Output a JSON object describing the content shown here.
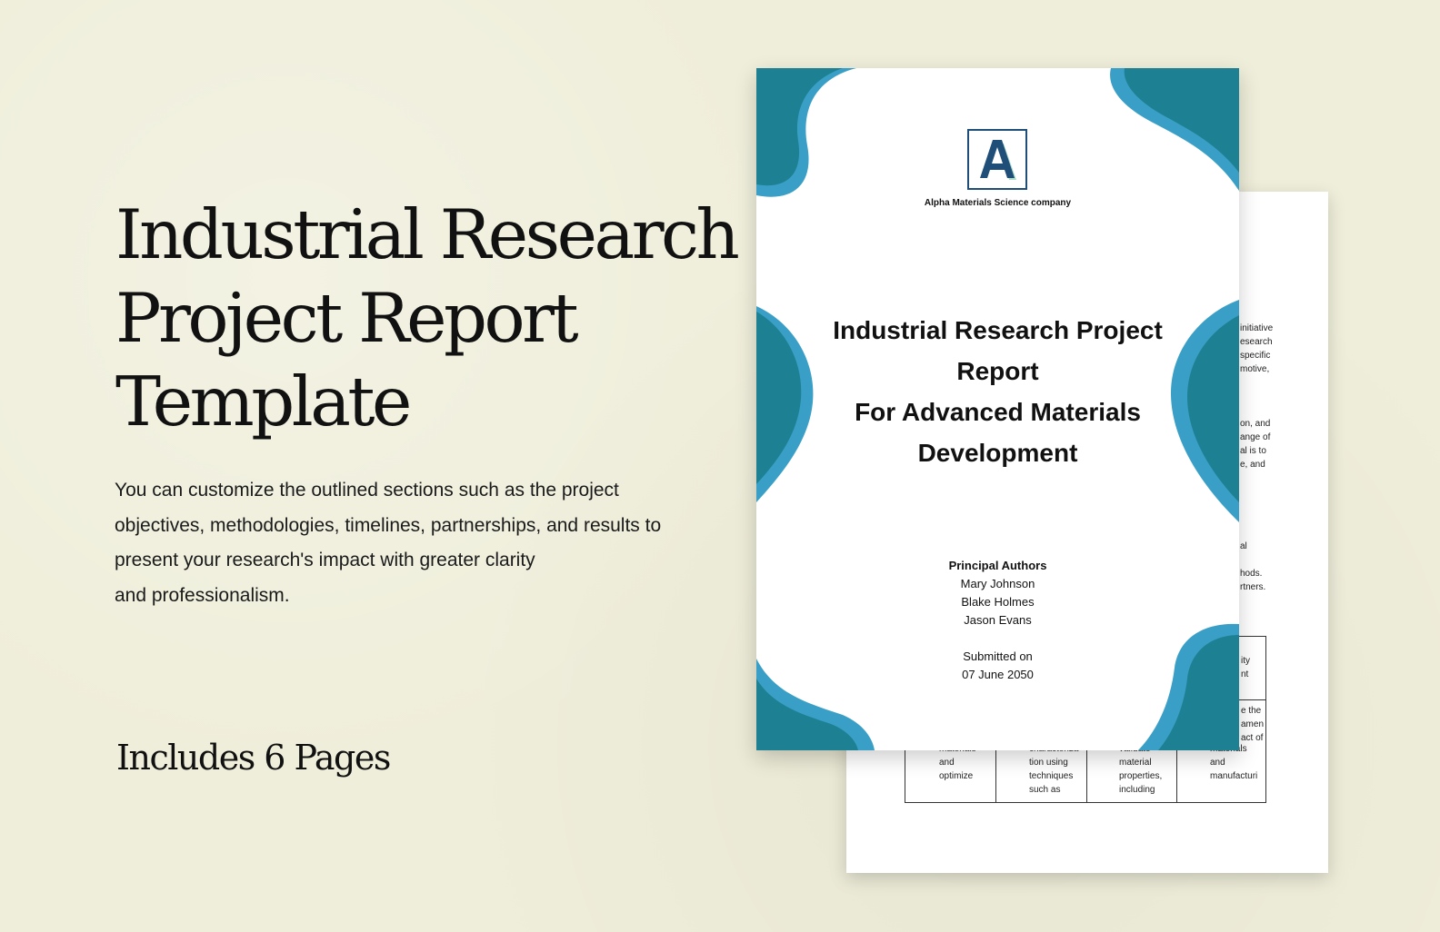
{
  "hero": {
    "title_lines": [
      "Industrial Research",
      "Project Report",
      "Template"
    ],
    "description_lines": [
      "You can customize the outlined sections such as the project",
      "objectives, methodologies, timelines, partnerships, and results to",
      "present your research's impact with greater clarity",
      "and professionalism."
    ],
    "pages_note": "Includes 6 Pages"
  },
  "cover": {
    "company": "Alpha Materials Science company",
    "logo_letter": "A",
    "title_lines": [
      "Industrial Research Project",
      "Report",
      "For Advanced Materials",
      "Development"
    ],
    "authors_label": "Principal Authors",
    "authors": [
      "Mary Johnson",
      "Blake Holmes",
      "Jason Evans"
    ],
    "submitted_label": "Submitted on",
    "submitted_date": "07 June 2050"
  },
  "back_page": {
    "fragments": [
      "initiative",
      "esearch",
      "specific",
      "motive,",
      "on, and",
      "ange of",
      "al is to",
      "e,  and",
      "al",
      "hods.",
      "rtners.",
      "ity",
      "nt",
      "e the",
      "amen",
      "act of"
    ],
    "table_cells": [
      [
        "materials",
        "and",
        "optimize"
      ],
      [
        "characteriza",
        "tion using",
        "techniques",
        "such as"
      ],
      [
        "validate",
        "material",
        "properties,",
        "including"
      ],
      [
        "materials",
        "and",
        "manufacturi"
      ]
    ]
  },
  "colors": {
    "background": "#efeeda",
    "teal_dark": "#1e8193",
    "teal_light": "#3a9fc6",
    "logo_navy": "#1f4e79",
    "logo_mint": "#a8dcc8"
  }
}
